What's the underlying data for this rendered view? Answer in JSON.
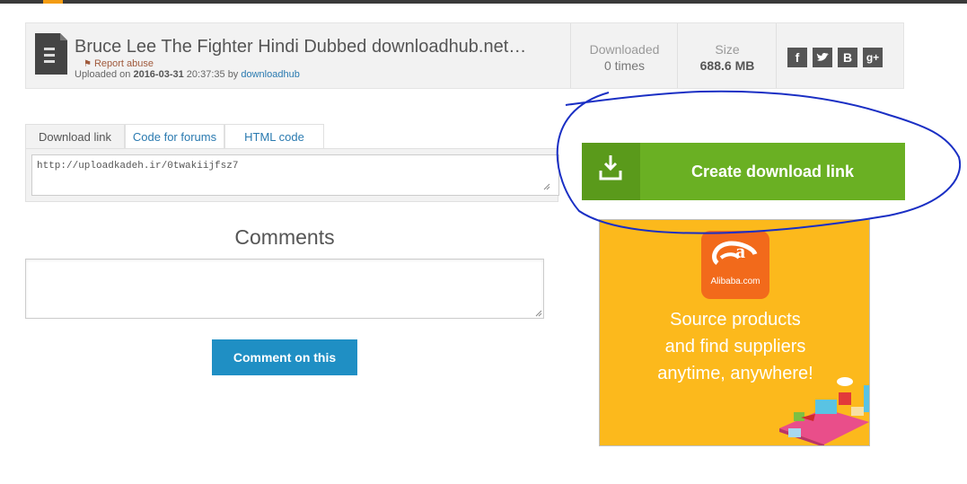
{
  "file": {
    "title": "Bruce Lee The Fighter Hindi Dubbed downloadhub.net…",
    "report_label": "Report abuse",
    "uploaded_prefix": "Uploaded on",
    "uploaded_date": "2016-03-31",
    "uploaded_time": "20:37:35",
    "uploaded_by_word": "by",
    "uploader": "downloadhub",
    "icon": "file-icon"
  },
  "stats": {
    "downloaded_label": "Downloaded",
    "downloaded_value": "0 times",
    "size_label": "Size",
    "size_value": "688.6 MB"
  },
  "social": [
    {
      "icon": "facebook-icon",
      "glyph": "f"
    },
    {
      "icon": "twitter-icon",
      "glyph": "🐦"
    },
    {
      "icon": "blogger-icon",
      "glyph": "B"
    },
    {
      "icon": "google-plus-icon",
      "glyph": "g+"
    }
  ],
  "tabs": [
    {
      "label": "Download link",
      "active": true
    },
    {
      "label": "Code for forums",
      "active": false
    },
    {
      "label": "HTML code",
      "active": false
    }
  ],
  "download_link_value": "http://uploadkadeh.ir/0twakiijfsz7",
  "comments": {
    "title": "Comments",
    "button_label": "Comment on this"
  },
  "create_download": {
    "label": "Create download link",
    "icon": "download-tray-icon"
  },
  "ad": {
    "brand": "Alibaba.com",
    "line1": "Source products",
    "line2": "and find suppliers",
    "line3": "anytime, anywhere!"
  },
  "colors": {
    "green_button": "#6ab023",
    "blue_button": "#1f8fc4",
    "ad_background": "#fcb91c",
    "annotation_ink": "#1a2fc4"
  }
}
